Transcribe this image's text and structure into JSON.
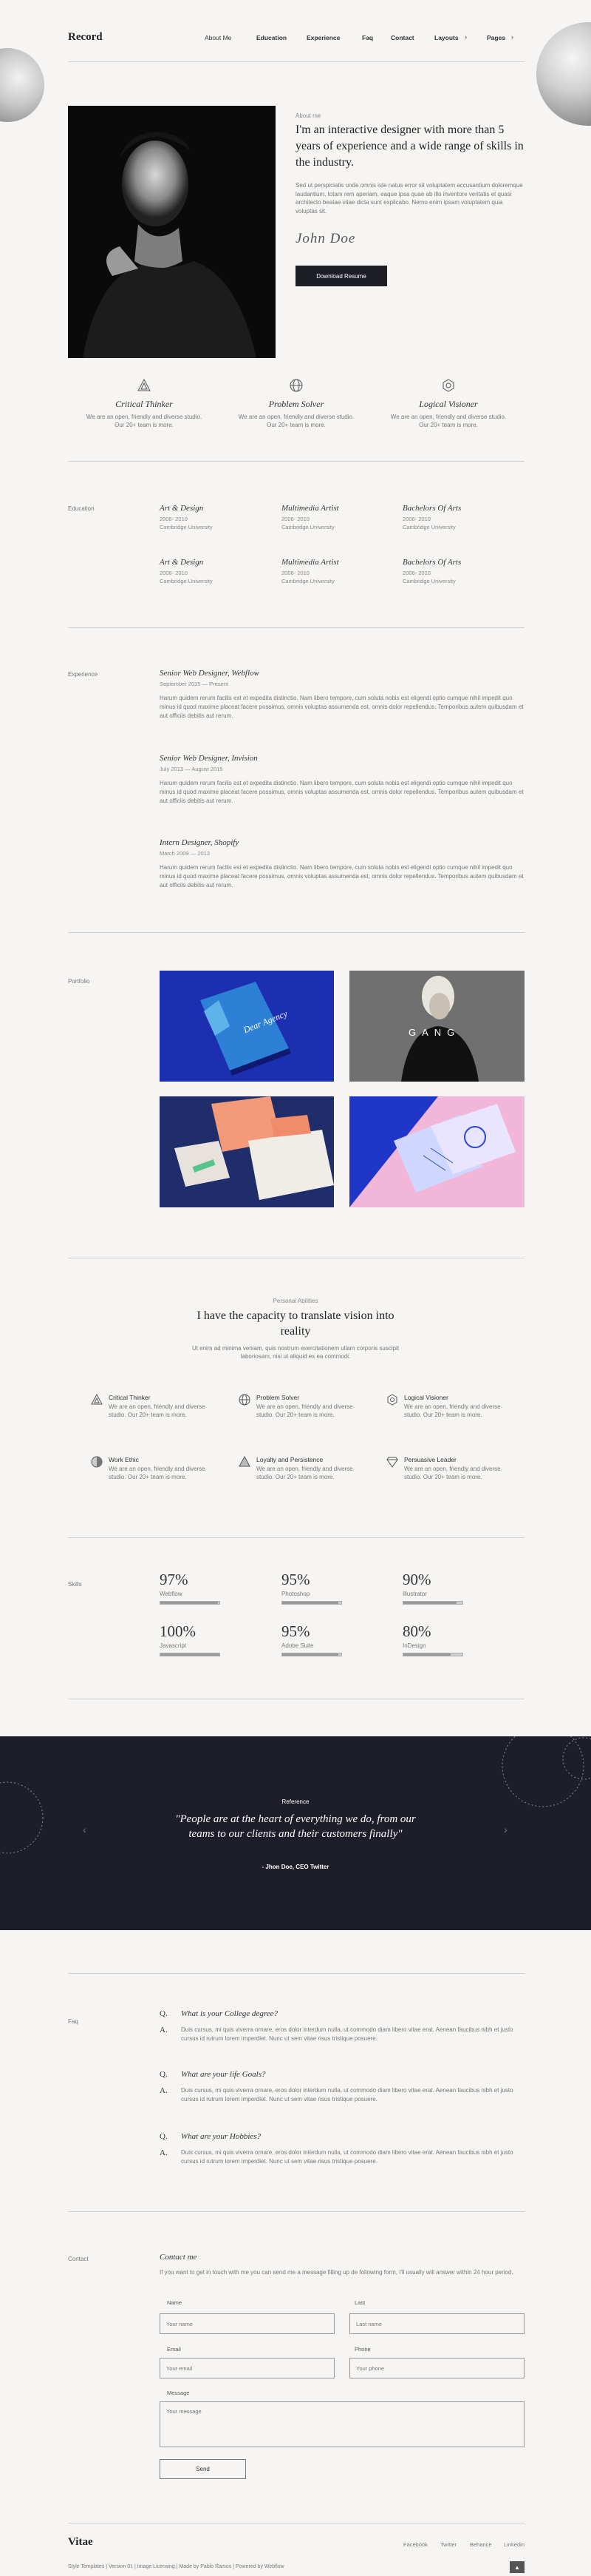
{
  "header": {
    "brand": "Record",
    "nav": [
      "About Me",
      "Education",
      "Experience",
      "Faq",
      "Contact",
      "Layouts",
      "Pages"
    ]
  },
  "hero": {
    "kicker": "About me",
    "headline": "I'm an interactive designer with more than 5 years of experience and a wide range of skills in the industry.",
    "body": "Sed ut perspiciatis unde omnis iste natus error sit voluptatem accusantium doloremque laudantium, totam rem aperiam, eaque ipsa quae ab illo inventore veritatis et quasi architecto beatae vitae dicta sunt explicabo. Nemo enim ipsam voluptatem quia voluptas sit.",
    "signature": "John Doe",
    "button": "Download Resume"
  },
  "features": [
    {
      "icon": "triangle-icon",
      "title": "Critical Thinker",
      "desc": "We are an open, friendly and diverse studio. Our 20+ team is more."
    },
    {
      "icon": "globe-icon",
      "title": "Problem Solver",
      "desc": "We are an open, friendly and diverse studio. Our 20+ team is more."
    },
    {
      "icon": "hexagon-icon",
      "title": "Logical Visioner",
      "desc": "We are an open, friendly and diverse studio. Our 20+ team is more."
    }
  ],
  "education": {
    "label": "Education",
    "items": [
      {
        "title": "Art & Design",
        "years": "2006- 2010",
        "school": "Cambridge University"
      },
      {
        "title": "Multimedia Artist",
        "years": "2006- 2010",
        "school": "Cambridge University"
      },
      {
        "title": "Bachelors Of Arts",
        "years": "2006- 2010",
        "school": "Cambridge University"
      },
      {
        "title": "Art & Design",
        "years": "2006- 2010",
        "school": "Cambridge University"
      },
      {
        "title": "Multimedia Artist",
        "years": "2006- 2010",
        "school": "Cambridge University"
      },
      {
        "title": "Bachelors Of Arts",
        "years": "2006- 2010",
        "school": "Cambridge University"
      }
    ]
  },
  "experience": {
    "label": "Experience",
    "items": [
      {
        "title": "Senior Web Designer, Webflow",
        "dates": "September 2015 — Present",
        "desc": "Harum quidem rerum facilis est et expedita distinctio. Nam libero tempore, cum soluta nobis est eligendi optio cumque nihil impedit quo minus id quod maxime placeat facere possimus, omnis voluptas assumenda est, omnis dolor repellendus. Temporibus autem quibusdam et aut officiis debitis aut rerum."
      },
      {
        "title": "Senior Web Designer, Invision",
        "dates": "July 2013 — August 2015",
        "desc": "Harum quidem rerum facilis est et expedita distinctio. Nam libero tempore, cum soluta nobis est eligendi optio cumque nihil impedit quo minus id quod maxime placeat facere possimus, omnis voluptas assumenda est, omnis dolor repellendus. Temporibus autem quibusdam et aut officiis debitis aut rerum."
      },
      {
        "title": "Intern Designer, Shopify",
        "dates": "March 2009 — 2013",
        "desc": "Harum quidem rerum facilis est et expedita distinctio. Nam libero tempore, cum soluta nobis est eligendi optio cumque nihil impedit quo minus id quod maxime placeat facere possimus, omnis voluptas assumenda est, omnis dolor repellendus. Temporibus autem quibusdam et aut officiis debitis aut rerum."
      }
    ]
  },
  "portfolio": {
    "label": "Portfolio",
    "tiles": [
      {
        "caption": "Dear Agency",
        "bg": "#1b2fb0"
      },
      {
        "caption": "GANG",
        "bg": "#6a6a6a"
      },
      {
        "caption": "",
        "bg": "#1f2d6b"
      },
      {
        "caption": "",
        "bg": "#f2b6d8"
      }
    ]
  },
  "abilities": {
    "kicker": "Personal Abilities",
    "heading": "I have the capacity to translate vision into reality",
    "sub": "Ut enim ad minima veniam, quis nostrum exercitationem ullam corporis suscipit laboriosam, nisi ut aliquid ex ea commodi.",
    "items": [
      {
        "icon": "triangle-icon",
        "title": "Critical Thinker",
        "desc": "We are an open, friendly and diverse studio. Our 20+ team is more."
      },
      {
        "icon": "globe-icon",
        "title": "Problem Solver",
        "desc": "We are an open, friendly and diverse studio. Our 20+ team is more."
      },
      {
        "icon": "hexagon-icon",
        "title": "Logical Visioner",
        "desc": "We are an open, friendly and diverse studio. Our 20+ team is more."
      },
      {
        "icon": "half-circle-icon",
        "title": "Work Ethic",
        "desc": "We are an open, friendly and diverse studio. Our 20+ team is more."
      },
      {
        "icon": "triangle-icon",
        "title": "Loyalty and Persistence",
        "desc": "We are an open, friendly and diverse studio. Our 20+ team is more."
      },
      {
        "icon": "diamond-icon",
        "title": "Persuasive Leader",
        "desc": "We are an open, friendly and diverse studio. Our 20+ team is more."
      }
    ]
  },
  "skills": {
    "label": "Skills",
    "items": [
      {
        "percent": "97%",
        "name": "Webflow",
        "level": 0.97
      },
      {
        "percent": "95%",
        "name": "Photoshop",
        "level": 0.95
      },
      {
        "percent": "90%",
        "name": "Illustrator",
        "level": 0.9
      },
      {
        "percent": "100%",
        "name": "Javascript",
        "level": 1.0
      },
      {
        "percent": "95%",
        "name": "Adobe Suite",
        "level": 0.95
      },
      {
        "percent": "80%",
        "name": "InDesign",
        "level": 0.8
      }
    ]
  },
  "reference": {
    "kicker": "Reference",
    "quote": "\"People are at the heart of everything we do, from our teams to our clients and their customers finally\"",
    "author": "- Jhon Doe, CEO Twitter",
    "bg": "#1e1e2a"
  },
  "faq": {
    "label": "Faq",
    "items": [
      {
        "q": "What is your College degree?",
        "a": "Duis cursus, mi quis viverra ornare, eros dolor interdum nulla, ut commodo diam libero vitae erat. Aenean faucibus nibh et justo cursus id rutrum lorem imperdiet. Nunc ut sem vitae risus tristique posuere."
      },
      {
        "q": "What are your life Goals?",
        "a": "Duis cursus, mi quis viverra ornare, eros dolor interdum nulla, ut commodo diam libero vitae erat. Aenean faucibus nibh et justo cursus id rutrum lorem imperdiet. Nunc ut sem vitae risus tristique posuere."
      },
      {
        "q": "What are your Hobbies?",
        "a": "Duis cursus, mi quis viverra ornare, eros dolor interdum nulla, ut commodo diam libero vitae erat. Aenean faucibus nibh et justo cursus id rutrum lorem imperdiet. Nunc ut sem vitae risus tristique posuere."
      }
    ]
  },
  "contact": {
    "label": "Contact",
    "title": "Contact me",
    "intro": "If you want to get in touch with me you can send me a message filling up de following form, I'll usually will answer within 24 hour period.",
    "name_label": "Name",
    "name_placeholder": "Your name",
    "last_label": "Last",
    "last_placeholder": "Last name",
    "email_label": "Email",
    "email_placeholder": "Your email",
    "phone_label": "Phone",
    "phone_placeholder": "Your phone",
    "message_label": "Message",
    "message_placeholder": "Your message",
    "send": "Send"
  },
  "footer": {
    "brand": "Vitae",
    "links": [
      "Facebook",
      "Twitter",
      "Behance",
      "Linkedin"
    ],
    "bottom": "Style Templates | Version 01 | Image Licensing | Made by Pablo Ramos | Powered by Webflow"
  }
}
